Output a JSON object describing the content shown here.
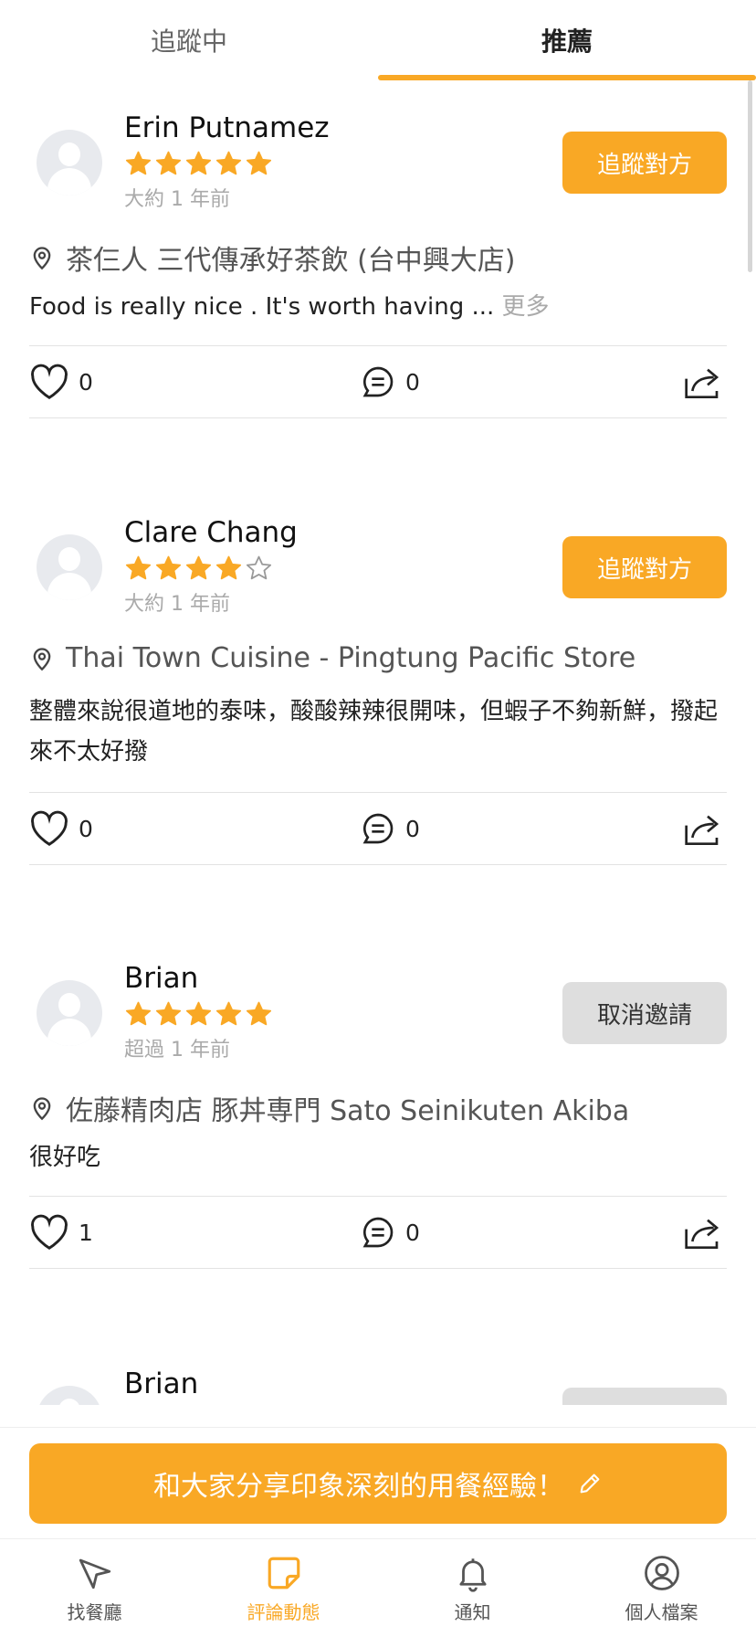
{
  "tabs": [
    {
      "label": "追蹤中",
      "active": false
    },
    {
      "label": "推薦",
      "active": true
    }
  ],
  "colors": {
    "accent": "#F9A825",
    "cancel_bg": "#dedede"
  },
  "reviews": [
    {
      "name": "Erin Putnamez",
      "rating": 5,
      "time": "大約 1 年前",
      "button": "追蹤對方",
      "place": "茶仨人 三代傳承好茶飲 (台中興大店)",
      "text": "Food is really nice . It's worth having ...",
      "more": "更多",
      "likes": "0",
      "comments": "0"
    },
    {
      "name": "Clare Chang",
      "rating": 4,
      "time": "大約 1 年前",
      "button": "追蹤對方",
      "place": "Thai Town Cuisine - Pingtung Pacific Store",
      "text": "整體來說很道地的泰味，酸酸辣辣很開味，但蝦子不夠新鮮，撥起來不太好撥",
      "likes": "0",
      "comments": "0"
    },
    {
      "name": "Brian",
      "rating": 5,
      "time": "超過 1 年前",
      "button": "取消邀請",
      "place": "佐藤精肉店 豚丼専門 Sato Seinikuten Akiba",
      "text": "很好吃",
      "likes": "1",
      "comments": "0"
    },
    {
      "name": "Brian"
    }
  ],
  "share": {
    "label": "和大家分享印象深刻的用餐經驗！",
    "icon": "pencil-icon"
  },
  "nav": [
    {
      "label": "找餐廳",
      "icon": "navigation-arrow-icon",
      "active": false
    },
    {
      "label": "評論動態",
      "icon": "sticky-note-icon",
      "active": true
    },
    {
      "label": "通知",
      "icon": "bell-icon",
      "active": false
    },
    {
      "label": "個人檔案",
      "icon": "profile-icon",
      "active": false
    }
  ]
}
